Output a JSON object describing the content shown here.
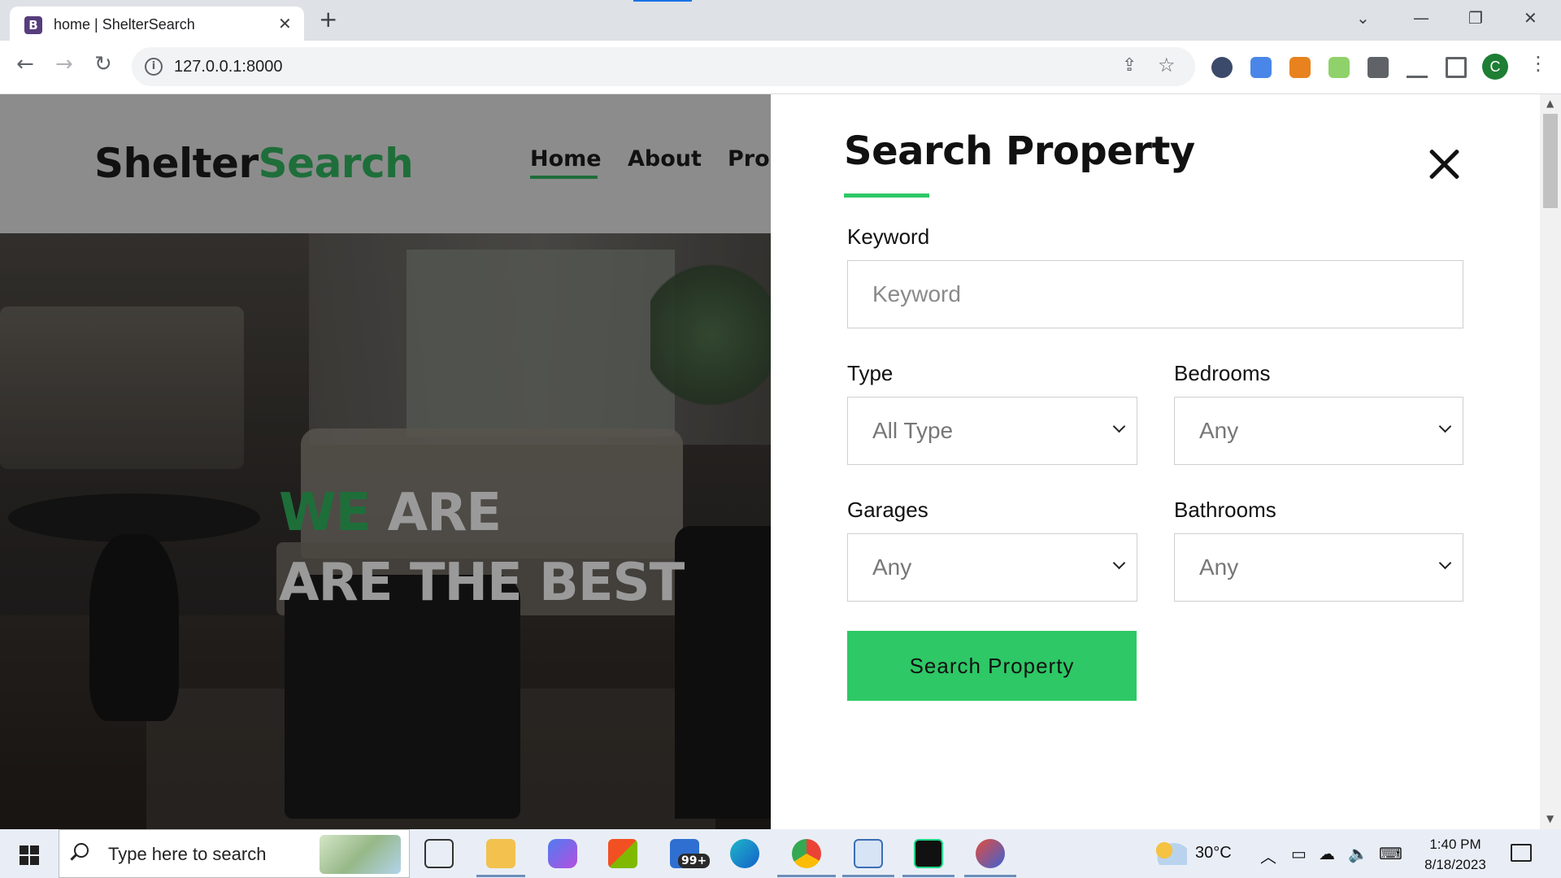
{
  "browser": {
    "tab_title": "home | ShelterSearch",
    "tab_favicon_letter": "B",
    "url": "127.0.0.1:8000",
    "profile_initial": "C"
  },
  "site": {
    "logo_part1": "Shelter",
    "logo_part2": "Search",
    "nav": [
      "Home",
      "About",
      "Prop"
    ],
    "active_nav": "Home",
    "hero_line1_green": "WE",
    "hero_line1_rest": "ARE",
    "hero_line2": "ARE THE BEST"
  },
  "search_panel": {
    "title": "Search Property",
    "keyword_label": "Keyword",
    "keyword_placeholder": "Keyword",
    "type_label": "Type",
    "type_value": "All Type",
    "bedrooms_label": "Bedrooms",
    "bedrooms_value": "Any",
    "garages_label": "Garages",
    "garages_value": "Any",
    "bathrooms_label": "Bathrooms",
    "bathrooms_value": "Any",
    "submit_label": "Search Property"
  },
  "taskbar": {
    "search_placeholder": "Type here to search",
    "mail_badge": "99+",
    "weather": "30°C",
    "time": "1:40 PM",
    "date": "8/18/2023"
  },
  "colors": {
    "accent_green": "#2ec866",
    "logo_green": "#1e6e3a",
    "chrome_blue": "#1a73e8"
  }
}
